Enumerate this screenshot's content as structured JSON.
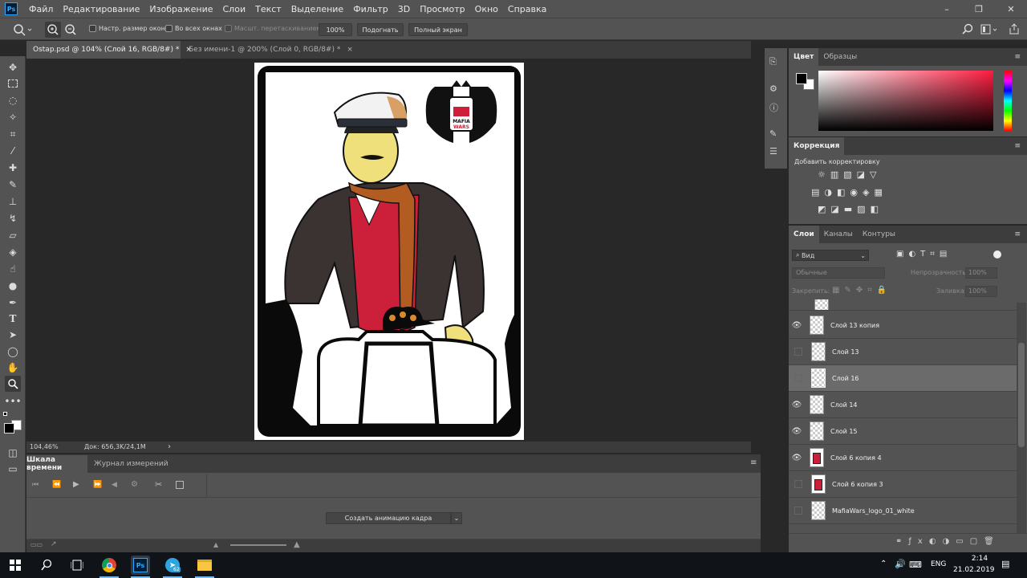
{
  "app": {
    "logo": "Ps"
  },
  "menu": [
    "Файл",
    "Редактирование",
    "Изображение",
    "Слои",
    "Текст",
    "Выделение",
    "Фильтр",
    "3D",
    "Просмотр",
    "Окно",
    "Справка"
  ],
  "window_controls": {
    "minimize": "–",
    "restore": "❐",
    "close": "✕"
  },
  "options": {
    "resize_windows_label": "Настр. размер окон",
    "all_windows_label": "Во всех окнах",
    "scrubby_zoom_label": "Масшт. перетаскиванием",
    "zoom_value": "100%",
    "fit_label": "Подогнать",
    "fullscreen_label": "Полный экран"
  },
  "tabs": [
    {
      "label": "Ostap.psd @ 104% (Слой 16, RGB/8#) *",
      "close": "×",
      "active": true
    },
    {
      "label": "Без имени-1 @ 200% (Слой 0, RGB/8#) *",
      "close": "×",
      "active": false
    }
  ],
  "status": {
    "zoom": "104,46%",
    "doc": "Док: 656,3K/24,1M",
    "arrow": "›"
  },
  "timeline": {
    "tabs": [
      "Шкала времени",
      "Журнал измерений"
    ],
    "create_button": "Создать анимацию кадра"
  },
  "color_panel": {
    "tabs": [
      "Цвет",
      "Образцы"
    ],
    "fg": "#000000",
    "bg": "#ffffff",
    "hue_top": "#ff3a5a"
  },
  "adjustments": {
    "tab": "Коррекция",
    "add_label": "Добавить корректировку"
  },
  "layers_panel": {
    "tabs": [
      "Слои",
      "Каналы",
      "Контуры"
    ],
    "filter_label": "Вид",
    "blend_mode": "Обычные",
    "opacity_label": "Непрозрачность:",
    "opacity_value": "100%",
    "lock_label": "Закрепить:",
    "fill_label": "Заливка:",
    "fill_value": "100%",
    "layers": [
      {
        "name": "Слой 13 копия",
        "visible": true,
        "selected": false
      },
      {
        "name": "Слой 13",
        "visible": false,
        "selected": false
      },
      {
        "name": "Слой 16",
        "visible": false,
        "selected": true
      },
      {
        "name": "Слой 14",
        "visible": true,
        "selected": false
      },
      {
        "name": "Слой 15",
        "visible": true,
        "selected": false
      },
      {
        "name": "Слой 6 копия 4",
        "visible": true,
        "selected": false
      },
      {
        "name": "Слой 6 копия 3",
        "visible": false,
        "selected": false
      },
      {
        "name": "MafiaWars_logo_01_white",
        "visible": false,
        "selected": false
      }
    ]
  },
  "artwork": {
    "logo_line1": "MAFIA",
    "logo_line2": "WARS"
  },
  "taskbar": {
    "lang": "ENG",
    "time": "2:14",
    "date": "21.02.2019",
    "ps_label": "Ps",
    "telegram_badge": "62"
  }
}
